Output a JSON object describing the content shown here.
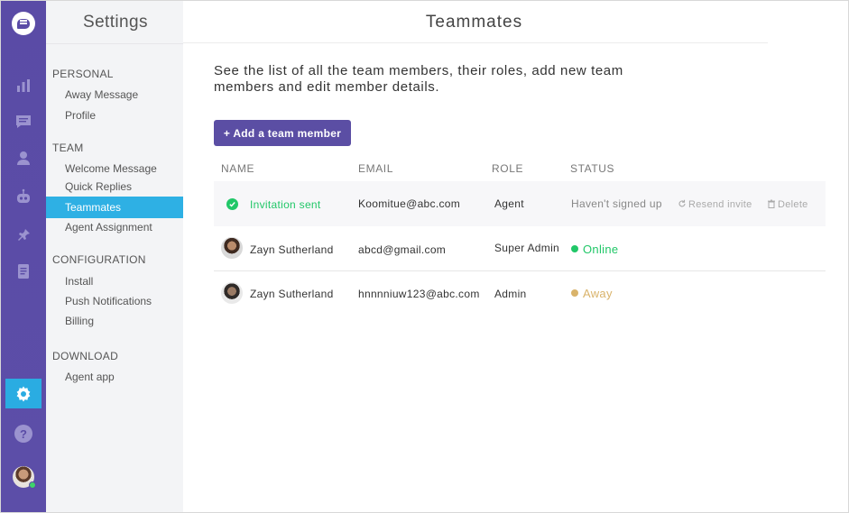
{
  "rail": {
    "colors": {
      "background": "#5a4ba6",
      "active": "#2aace2",
      "icon": "#9b93cf"
    },
    "icons": [
      "logo-icon",
      "reports-icon",
      "conversations-icon",
      "contacts-icon",
      "bot-icon",
      "integrations-icon",
      "docs-icon",
      "settings-icon",
      "help-icon",
      "user-avatar"
    ],
    "help_glyph": "?"
  },
  "sidebar": {
    "title": "Settings",
    "sections": [
      {
        "heading": "PERSONAL",
        "items": [
          "Away Message",
          "Profile"
        ]
      },
      {
        "heading": "TEAM",
        "items": [
          "Welcome Message",
          "Quick Replies",
          "Teammates",
          "Agent Assignment"
        ]
      },
      {
        "heading": "CONFIGURATION",
        "items": [
          "Install",
          "Push Notifications",
          "Billing"
        ]
      },
      {
        "heading": "DOWNLOAD",
        "items": [
          "Agent app"
        ]
      }
    ],
    "active_item": "Teammates",
    "active_color": "#2eb0e4"
  },
  "main": {
    "title": "Teammates",
    "description": "See the list of all the team members, their roles, add new team members and edit member details.",
    "add_button": "+ Add a team member",
    "columns": [
      "NAME",
      "EMAIL",
      "ROLE",
      "STATUS"
    ],
    "invite_row": {
      "name": "Invitation sent",
      "email": "Koomitue@abc.com",
      "role": "Agent",
      "status": "Haven't signed up",
      "resend": "Resend invite",
      "delete": "Delete"
    },
    "members": [
      {
        "name": "Zayn Sutherland",
        "email": "abcd@gmail.com",
        "role": "Super Admin",
        "status": "Online",
        "status_color": "#21c768"
      },
      {
        "name": "Zayn Sutherland",
        "email": "hnnnniuw123@abc.com",
        "role": "Admin",
        "status": "Away",
        "status_color": "#d9b36a"
      }
    ]
  }
}
